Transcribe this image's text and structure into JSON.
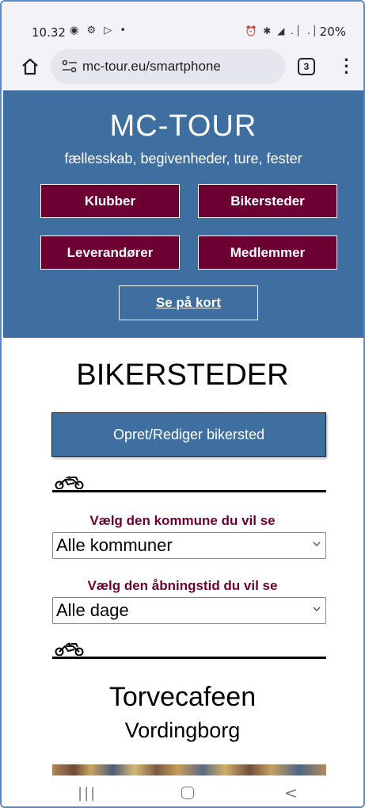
{
  "status_bar": {
    "time": "10.32",
    "left_icons": "◉ ⚙ ▷ •",
    "right_icons": "⏰ ✱ ◢ .│ .│",
    "battery": "20%"
  },
  "browser": {
    "url": "mc-tour.eu/smartphone",
    "tab_count": "3",
    "icons": [
      "home-icon",
      "tune-icon",
      "tabs-icon",
      "overflow-menu-icon"
    ]
  },
  "header": {
    "title": "MC-TOUR",
    "tagline": "fællesskab, begivenheder, ture, fester",
    "nav": {
      "klubber": "Klubber",
      "bikersteder": "Bikersteder",
      "leverandorer": "Leverandører",
      "medlemmer": "Medlemmer"
    },
    "map_link": "Se på kort",
    "colors": {
      "background": "#3f6fa0",
      "button": "#6c0033"
    }
  },
  "main": {
    "heading": "BIKERSTEDER",
    "create_button": "Opret/Rediger bikersted",
    "filters": {
      "kommune_label": "Vælg den kommune du vil se",
      "kommune_value": "Alle kommuner",
      "aabningstid_label": "Vælg den åbningstid du vil se",
      "aabningstid_value": "Alle dage"
    },
    "venue": {
      "name": "Torvecafeen",
      "city": "Vordingborg"
    }
  },
  "system_nav": {
    "recent": "|||",
    "back": "<"
  }
}
